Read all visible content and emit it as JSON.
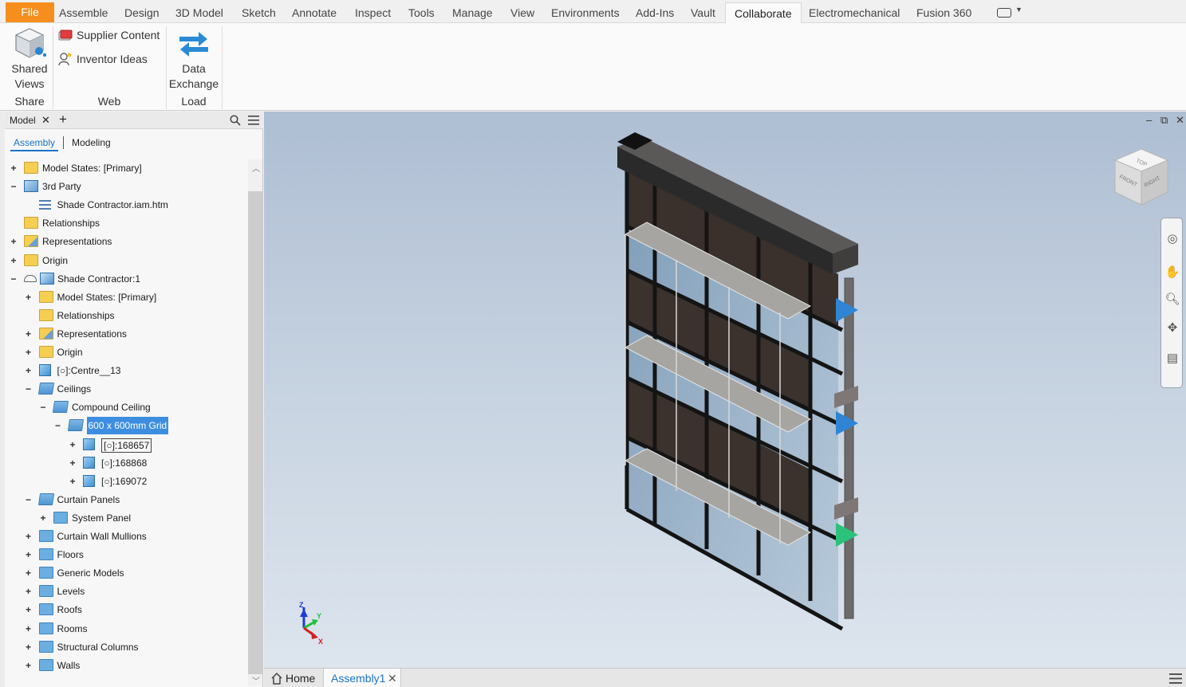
{
  "menu": {
    "file": "File",
    "tabs": [
      "Assemble",
      "Design",
      "3D Model",
      "Sketch",
      "Annotate",
      "Inspect",
      "Tools",
      "Manage",
      "View",
      "Environments",
      "Add-Ins",
      "Vault",
      "Collaborate",
      "Electromechanical",
      "Fusion 360"
    ],
    "active_tab": "Collaborate"
  },
  "ribbon": {
    "shared_views_line1": "Shared",
    "shared_views_line2": "Views",
    "supplier_content": "Supplier Content",
    "inventor_ideas": "Inventor Ideas",
    "data_exchange_line1": "Data",
    "data_exchange_line2": "Exchange",
    "panels": {
      "share": "Share",
      "web": "Web",
      "load": "Load"
    }
  },
  "browser": {
    "tab": "Model",
    "close": "✕",
    "add": "+",
    "subtab_assembly": "Assembly",
    "subtab_modeling": "Modeling",
    "tree": [
      {
        "label": "Model States: [Primary]",
        "exp": "+",
        "icon": "folder-yellow",
        "level": 0
      },
      {
        "label": "3rd Party",
        "exp": "−",
        "icon": "third-party",
        "level": 0
      },
      {
        "label": "Shade Contractor.iam.htm",
        "exp": "",
        "icon": "list",
        "level": 1
      },
      {
        "label": "Relationships",
        "exp": "",
        "icon": "folder-yellow",
        "level": 0
      },
      {
        "label": "Representations",
        "exp": "+",
        "icon": "representations",
        "level": 0
      },
      {
        "label": "Origin",
        "exp": "+",
        "icon": "folder-yellow",
        "level": 0
      },
      {
        "label": "Shade Contractor:1",
        "exp": "−",
        "icon": "assembly",
        "level": 0
      },
      {
        "label": "Model States: [Primary]",
        "exp": "+",
        "icon": "folder-yellow",
        "level": 1
      },
      {
        "label": "Relationships",
        "exp": "",
        "icon": "folder-yellow",
        "level": 1
      },
      {
        "label": "Representations",
        "exp": "+",
        "icon": "representations",
        "level": 1
      },
      {
        "label": "Origin",
        "exp": "+",
        "icon": "folder-yellow",
        "level": 1
      },
      {
        "label": "[○]:Centre__13",
        "exp": "+",
        "icon": "part",
        "level": 1
      },
      {
        "label": "Ceilings",
        "exp": "−",
        "icon": "folder-open",
        "level": 1
      },
      {
        "label": "Compound Ceiling",
        "exp": "−",
        "icon": "folder-open",
        "level": 2
      },
      {
        "label": "600 x 600mm Grid",
        "exp": "−",
        "icon": "folder-open",
        "level": 3,
        "selected": true
      },
      {
        "label": "[○]:168657",
        "exp": "+",
        "icon": "part",
        "level": 4,
        "boxed": true
      },
      {
        "label": "[○]:168868",
        "exp": "+",
        "icon": "part",
        "level": 4
      },
      {
        "label": "[○]:169072",
        "exp": "+",
        "icon": "part",
        "level": 4
      },
      {
        "label": "Curtain Panels",
        "exp": "−",
        "icon": "folder-open",
        "level": 1
      },
      {
        "label": "System Panel",
        "exp": "+",
        "icon": "folder-blue",
        "level": 2
      },
      {
        "label": "Curtain Wall Mullions",
        "exp": "+",
        "icon": "folder-blue",
        "level": 1
      },
      {
        "label": "Floors",
        "exp": "+",
        "icon": "folder-blue",
        "level": 1
      },
      {
        "label": "Generic Models",
        "exp": "+",
        "icon": "folder-blue",
        "level": 1
      },
      {
        "label": "Levels",
        "exp": "+",
        "icon": "folder-blue",
        "level": 1
      },
      {
        "label": "Roofs",
        "exp": "+",
        "icon": "folder-blue",
        "level": 1
      },
      {
        "label": "Rooms",
        "exp": "+",
        "icon": "folder-blue",
        "level": 1
      },
      {
        "label": "Structural Columns",
        "exp": "+",
        "icon": "folder-blue",
        "level": 1
      },
      {
        "label": "Walls",
        "exp": "+",
        "icon": "folder-blue",
        "level": 1
      }
    ]
  },
  "viewcube": {
    "top": "TOP",
    "front": "FRONT",
    "right": "RIGHT"
  },
  "triad": {
    "x": "X",
    "y": "Y",
    "z": "Z"
  },
  "bottom_tabs": {
    "home": "Home",
    "assembly": "Assembly1",
    "close": "✕"
  },
  "colors": {
    "file_tab": "#f68e1e",
    "selection": "#3d8ee0",
    "viewport_top": "#aebed3",
    "viewport_bottom": "#dde5ee"
  }
}
